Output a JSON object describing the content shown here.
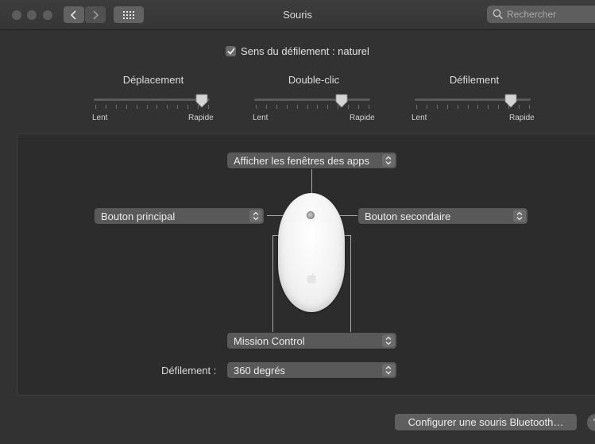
{
  "window": {
    "title": "Souris"
  },
  "search": {
    "placeholder": "Rechercher"
  },
  "scroll_direction": {
    "label": "Sens du défilement : naturel",
    "checked": true
  },
  "sliders": [
    {
      "title": "Déplacement",
      "min_label": "Lent",
      "max_label": "Rapide",
      "value_fraction": 0.93
    },
    {
      "title": "Double-clic",
      "min_label": "Lent",
      "max_label": "Rapide",
      "value_fraction": 0.75
    },
    {
      "title": "Défilement",
      "min_label": "Lent",
      "max_label": "Rapide",
      "value_fraction": 0.83
    }
  ],
  "mouse_buttons": {
    "top": "Afficher les fenêtres des apps",
    "left": "Bouton principal",
    "right": "Bouton secondaire",
    "bottom": "Mission Control"
  },
  "scroll": {
    "label": "Défilement :",
    "value": "360 degrés"
  },
  "bluetooth_button": "Configurer une souris Bluetooth…",
  "help_label": "?",
  "icons": {
    "back": "chevron-left-icon",
    "forward": "chevron-right-icon",
    "show_all": "grid-icon",
    "search": "magnifier-icon",
    "mouse_logo": "apple-logo-icon"
  },
  "colors": {
    "background": "#323232",
    "panel": "#2c2c2c",
    "control": "#595959"
  }
}
